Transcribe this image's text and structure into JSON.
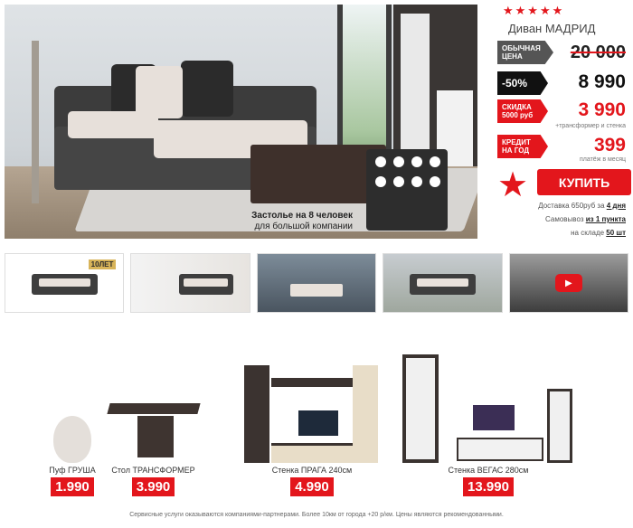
{
  "hero": {
    "caption_line1": "Застолье на 8 человек",
    "caption_line2": "для большой компании"
  },
  "product": {
    "rating_stars": "★★★★★",
    "title": "Диван МАДРИД",
    "regular_label_1": "ОБЫЧНАЯ",
    "regular_label_2": "ЦЕНА",
    "old_price": "20 000",
    "discount_label": "-50%",
    "current_price": "8 990",
    "bundle_label_1": "СКИДКА",
    "bundle_label_2": "5000 руб",
    "bundle_price": "3 990",
    "bundle_note": "+трансформер и стенка",
    "credit_label_1": "КРЕДИТ",
    "credit_label_2": "НА ГОД",
    "credit_price": "399",
    "credit_note": "платёж в месяц",
    "buy_label": "КУПИТЬ",
    "delivery_text": "Доставка 650руб за ",
    "delivery_days": "4 дня",
    "pickup_text": "Самовывоз ",
    "pickup_points": "из 1 пункта",
    "stock_text": "на складе ",
    "stock_count": "50 шт"
  },
  "thumbs": {
    "badge": "10ЛЕТ",
    "video_icon": "play-icon"
  },
  "related": [
    {
      "name": "Пуф ГРУША",
      "price": "1.990"
    },
    {
      "name": "Стол ТРАНСФОРМЕР",
      "price": "3.990"
    },
    {
      "name": "Стенка ПРАГА 240см",
      "price": "4.990"
    },
    {
      "name": "Стенка ВЕГАС 280см",
      "price": "13.990"
    }
  ],
  "footer": "Сервисные услуги оказываются компаниями-партнерами. Более 10км от города +20 р/км. Цены являются рекомендованными.",
  "colors": {
    "accent": "#e3161c",
    "dark": "#111111"
  }
}
